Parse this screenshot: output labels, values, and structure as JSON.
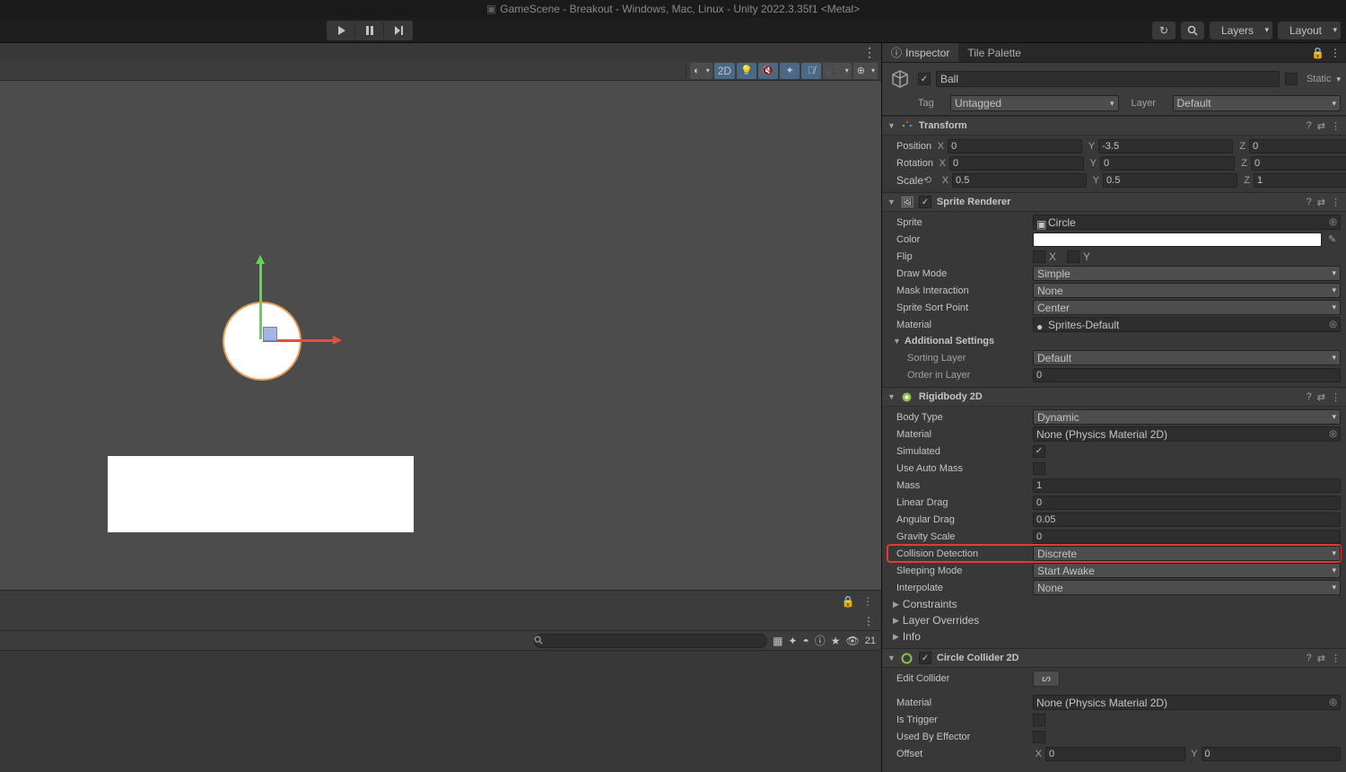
{
  "window_title": "GameScene - Breakout - Windows, Mac, Linux - Unity 2022.3.35f1 <Metal>",
  "toolbar": {
    "layers_label": "Layers",
    "layout_label": "Layout"
  },
  "scene_toolbar": {
    "twod": "2D"
  },
  "console": {
    "eye_count": "21"
  },
  "inspector": {
    "tabs": {
      "inspector": "Inspector",
      "tile_palette": "Tile Palette"
    },
    "go": {
      "name": "Ball",
      "static": "Static",
      "tag_label": "Tag",
      "tag_value": "Untagged",
      "layer_label": "Layer",
      "layer_value": "Default"
    },
    "transform": {
      "title": "Transform",
      "position_label": "Position",
      "rotation_label": "Rotation",
      "scale_label": "Scale",
      "pos": {
        "x": "0",
        "y": "-3.5",
        "z": "0"
      },
      "rot": {
        "x": "0",
        "y": "0",
        "z": "0"
      },
      "scale": {
        "x": "0.5",
        "y": "0.5",
        "z": "1"
      }
    },
    "sprite_renderer": {
      "title": "Sprite Renderer",
      "sprite_label": "Sprite",
      "sprite_value": "Circle",
      "color_label": "Color",
      "flip_label": "Flip",
      "flip_x": "X",
      "flip_y": "Y",
      "drawmode_label": "Draw Mode",
      "drawmode_value": "Simple",
      "mask_label": "Mask Interaction",
      "mask_value": "None",
      "sortpoint_label": "Sprite Sort Point",
      "sortpoint_value": "Center",
      "material_label": "Material",
      "material_value": "Sprites-Default",
      "additional_label": "Additional Settings",
      "sorting_layer_label": "Sorting Layer",
      "sorting_layer_value": "Default",
      "order_label": "Order in Layer",
      "order_value": "0"
    },
    "rigidbody": {
      "title": "Rigidbody 2D",
      "bodytype_label": "Body Type",
      "bodytype_value": "Dynamic",
      "material_label": "Material",
      "material_value": "None (Physics Material 2D)",
      "simulated_label": "Simulated",
      "useautomass_label": "Use Auto Mass",
      "mass_label": "Mass",
      "mass_value": "1",
      "lineardrag_label": "Linear Drag",
      "lineardrag_value": "0",
      "angulardrag_label": "Angular Drag",
      "angulardrag_value": "0.05",
      "gravscale_label": "Gravity Scale",
      "gravscale_value": "0",
      "colldet_label": "Collision Detection",
      "colldet_value": "Discrete",
      "sleep_label": "Sleeping Mode",
      "sleep_value": "Start Awake",
      "interp_label": "Interpolate",
      "interp_value": "None",
      "constraints_label": "Constraints",
      "layerov_label": "Layer Overrides",
      "info_label": "Info"
    },
    "circle_collider": {
      "title": "Circle Collider 2D",
      "edit_label": "Edit Collider",
      "material_label": "Material",
      "material_value": "None (Physics Material 2D)",
      "istrigger_label": "Is Trigger",
      "usedby_label": "Used By Effector",
      "offset_label": "Offset",
      "offset": {
        "x": "0",
        "y": "0"
      }
    }
  }
}
